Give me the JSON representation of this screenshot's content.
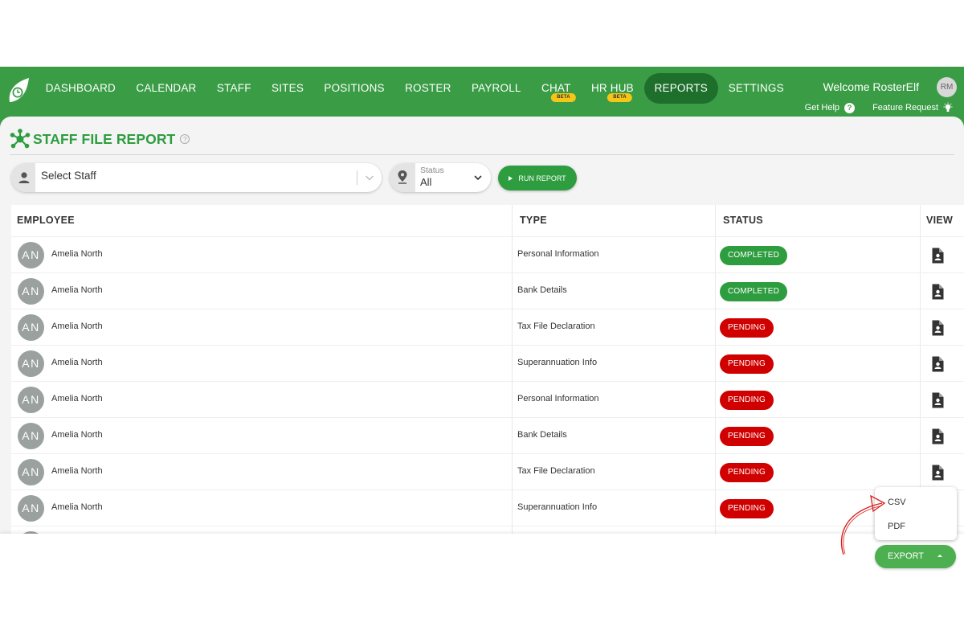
{
  "nav": {
    "items": [
      {
        "label": "DASHBOARD"
      },
      {
        "label": "CALENDAR"
      },
      {
        "label": "STAFF"
      },
      {
        "label": "SITES"
      },
      {
        "label": "POSITIONS"
      },
      {
        "label": "ROSTER"
      },
      {
        "label": "PAYROLL"
      },
      {
        "label": "CHAT",
        "badge": "BETA"
      },
      {
        "label": "HR HUB",
        "badge": "BETA"
      },
      {
        "label": "REPORTS",
        "active": true
      },
      {
        "label": "SETTINGS"
      }
    ],
    "welcome": "Welcome RosterElf",
    "user_initials": "RM",
    "get_help": "Get Help",
    "feature_request": "Feature Request"
  },
  "page": {
    "title": "STAFF FILE REPORT"
  },
  "filters": {
    "staff_placeholder": "Select Staff",
    "status_label": "Status",
    "status_value": "All",
    "run_label": "RUN REPORT"
  },
  "table": {
    "headers": {
      "employee": "EMPLOYEE",
      "type": "TYPE",
      "status": "STATUS",
      "view": "VIEW"
    },
    "rows": [
      {
        "initials": "AN",
        "name": "Amelia North",
        "type": "Personal Information",
        "status": "COMPLETED"
      },
      {
        "initials": "AN",
        "name": "Amelia North",
        "type": "Bank Details",
        "status": "COMPLETED"
      },
      {
        "initials": "AN",
        "name": "Amelia North",
        "type": "Tax File Declaration",
        "status": "PENDING"
      },
      {
        "initials": "AN",
        "name": "Amelia North",
        "type": "Superannuation Info",
        "status": "PENDING"
      },
      {
        "initials": "AN",
        "name": "Amelia North",
        "type": "Personal Information",
        "status": "PENDING"
      },
      {
        "initials": "AN",
        "name": "Amelia North",
        "type": "Bank Details",
        "status": "PENDING"
      },
      {
        "initials": "AN",
        "name": "Amelia North",
        "type": "Tax File Declaration",
        "status": "PENDING"
      },
      {
        "initials": "AN",
        "name": "Amelia North",
        "type": "Superannuation Info",
        "status": "PENDING"
      }
    ]
  },
  "export": {
    "button_label": "EXPORT",
    "options": [
      "CSV",
      "PDF"
    ]
  },
  "colors": {
    "brand_green": "#3a9d46",
    "active_nav": "#1e6f2c",
    "completed": "#2e9d3f",
    "pending": "#d00000",
    "beta": "#f5c518"
  }
}
